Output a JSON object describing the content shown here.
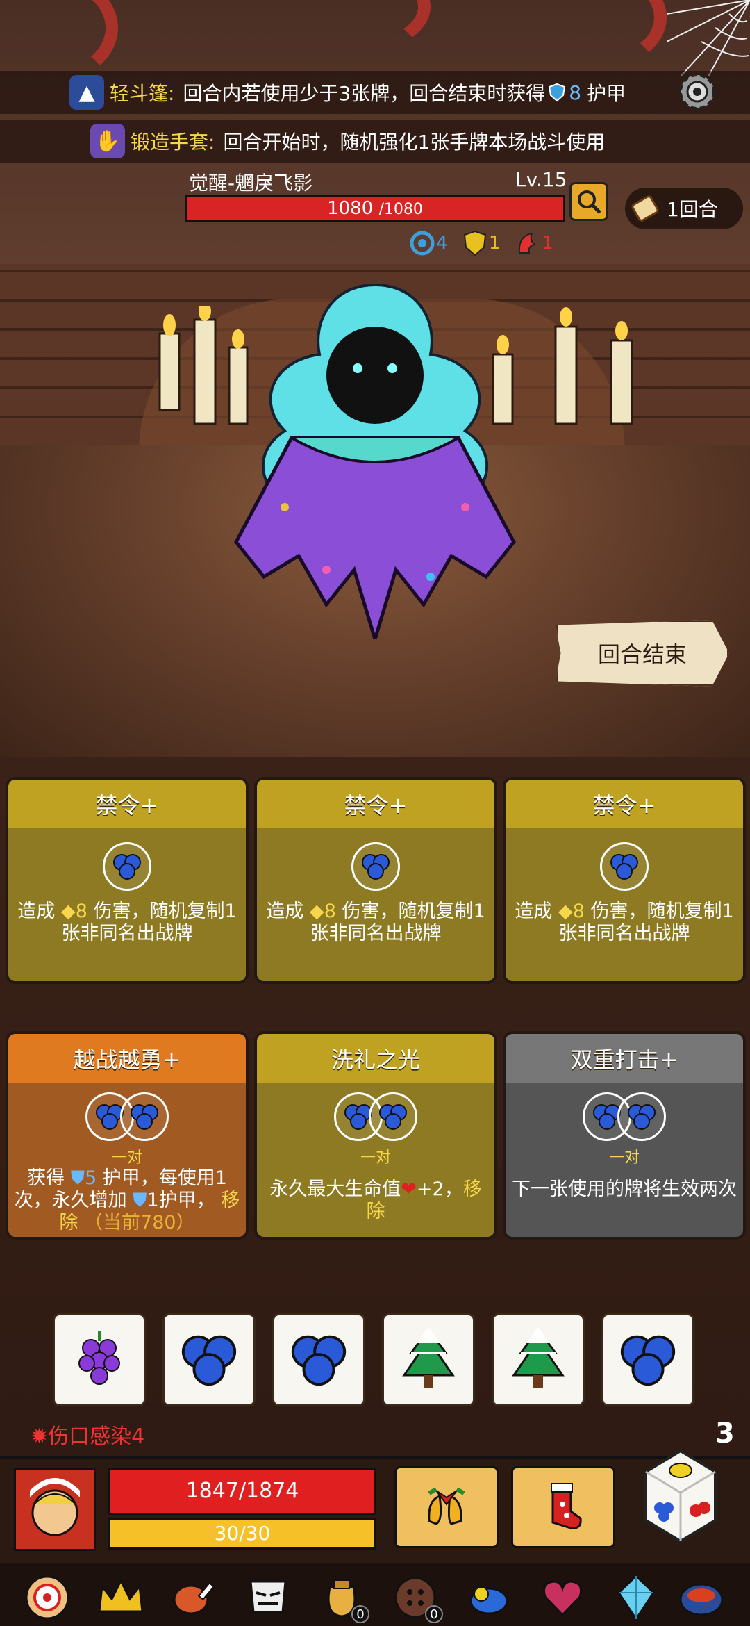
{
  "buffs": [
    {
      "name": "轻斗篷:",
      "desc": "回合内若使用少于3张牌，回合结束时获得",
      "armor_value": "8",
      "suffix": "护甲"
    },
    {
      "name": "锻造手套:",
      "desc": "回合开始时，随机强化1张手牌本场战斗使用"
    }
  ],
  "enemy": {
    "name": "觉醒-魍戾飞影",
    "level": "Lv.15",
    "hp_current": "1080",
    "hp_max": "/1080",
    "stats": [
      {
        "icon": "spiral-icon",
        "value": "4",
        "color": "#3aa0e0"
      },
      {
        "icon": "shield-icon",
        "value": "1",
        "color": "#e8c020"
      },
      {
        "icon": "claw-icon",
        "value": "1",
        "color": "#e03030"
      }
    ]
  },
  "round": {
    "label": "1回合"
  },
  "end_turn": {
    "label": "回合结束"
  },
  "cards_top": [
    {
      "title": "禁令+",
      "desc_pre": "造成",
      "value": "8",
      "desc_post": "伤害，随机复制1张非同名出战牌"
    },
    {
      "title": "禁令+",
      "desc_pre": "造成",
      "value": "8",
      "desc_post": "伤害，随机复制1张非同名出战牌"
    },
    {
      "title": "禁令+",
      "desc_pre": "造成",
      "value": "8",
      "desc_post": "伤害，随机复制1张非同名出战牌"
    }
  ],
  "cards_bottom": [
    {
      "title": "越战越勇+",
      "cost_label": "一对",
      "desc_a": "获得",
      "val_a": "5",
      "desc_b": "护甲，每使用1次，永久增加",
      "val_b": "1",
      "desc_c": "护甲，",
      "remove": "移除",
      "current": "（当前780）"
    },
    {
      "title": "洗礼之光",
      "cost_label": "一对",
      "desc": "永久最大生命值",
      "val": "+2，",
      "remove": "移除"
    },
    {
      "title": "双重打击+",
      "cost_label": "一对",
      "desc": "下一张使用的牌将生效两次"
    }
  ],
  "dice": [
    "grape-icon",
    "blueberry-icon",
    "blueberry-icon",
    "tree-icon",
    "tree-icon",
    "blueberry-icon"
  ],
  "player": {
    "status": "伤口感染4",
    "hp": "1847/1874",
    "energy": "30/30",
    "dice_count": "3"
  },
  "bottom_items": [
    {
      "icon": "target-icon",
      "badge": ""
    },
    {
      "icon": "crown-icon",
      "badge": ""
    },
    {
      "icon": "meat-icon",
      "badge": ""
    },
    {
      "icon": "mask-icon",
      "badge": ""
    },
    {
      "icon": "bag-icon",
      "badge": "0"
    },
    {
      "icon": "button-icon",
      "badge": "0"
    },
    {
      "icon": "bird-icon",
      "badge": ""
    },
    {
      "icon": "heart-icon",
      "badge": ""
    },
    {
      "icon": "crystal-icon",
      "badge": ""
    },
    {
      "icon": "pot-icon",
      "badge": ""
    }
  ],
  "colors": {
    "hp_red": "#d82424",
    "energy_yellow": "#f6c028",
    "card_gold": "#bfa222",
    "card_orange": "#e07a20",
    "card_gray": "#777777"
  }
}
